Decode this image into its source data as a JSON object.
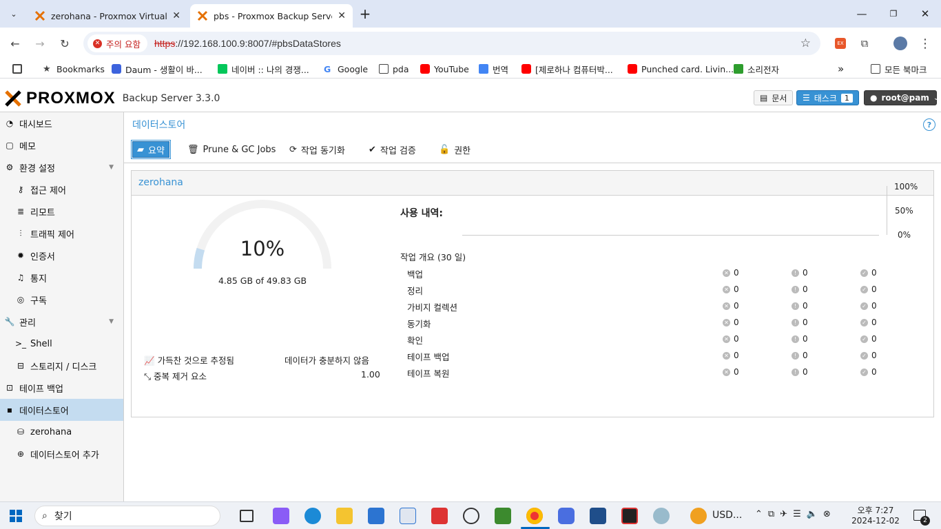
{
  "browser": {
    "tabs": [
      {
        "title": "zerohana - Proxmox Virtual Environment",
        "active": false
      },
      {
        "title": "pbs - Proxmox Backup Server",
        "active": true
      }
    ],
    "security_chip": "주의 요함",
    "url_proto": "https",
    "url_rest": "://192.168.100.9:8007/#pbsDataStores",
    "bookmarks": [
      {
        "label": "Bookmarks"
      },
      {
        "label": "Daum - 생활이 바..."
      },
      {
        "label": "네이버 :: 나의 경쟁..."
      },
      {
        "label": "Google"
      },
      {
        "label": "pda"
      },
      {
        "label": "YouTube"
      },
      {
        "label": "번역"
      },
      {
        "label": "[제로하나 컴퓨터박..."
      },
      {
        "label": "Punched card. Livin..."
      },
      {
        "label": "소리전자"
      }
    ],
    "all_bookmarks": "모든 북마크"
  },
  "pbs": {
    "brand": "PROXMOX",
    "version": "Backup Server 3.3.0",
    "docs_label": "문서",
    "tasks_label": "태스크",
    "tasks_count": "1",
    "user_label": "root@pam"
  },
  "sidebar": {
    "items": [
      {
        "label": "대시보드"
      },
      {
        "label": "메모"
      },
      {
        "label": "환경 설정"
      },
      {
        "label": "접근 제어"
      },
      {
        "label": "리모트"
      },
      {
        "label": "트래픽 제어"
      },
      {
        "label": "인증서"
      },
      {
        "label": "통지"
      },
      {
        "label": "구독"
      },
      {
        "label": "관리"
      },
      {
        "label": "Shell"
      },
      {
        "label": "스토리지 / 디스크"
      },
      {
        "label": "테이프 백업"
      },
      {
        "label": "데이터스토어"
      },
      {
        "label": "zerohana"
      },
      {
        "label": "데이터스토어 추가"
      }
    ]
  },
  "content": {
    "title": "데이터스토어",
    "tabs": [
      {
        "label": "요약"
      },
      {
        "label": "Prune & GC Jobs"
      },
      {
        "label": "작업 동기화"
      },
      {
        "label": "작업 검증"
      },
      {
        "label": "권한"
      }
    ],
    "panel_title": "zerohana",
    "usage_percent": "10%",
    "usage_fraction": 0.0974,
    "usage_text": "4.85 GB of 49.83 GB",
    "estimate_label": "가득찬 것으로 추정됨",
    "estimate_value": "데이터가 충분하지 않음",
    "dedup_label": "중복 제거 요소",
    "dedup_value": "1.00",
    "history_title": "사용 내역:",
    "axis": [
      "100%",
      "50%",
      "0%"
    ],
    "tasks_title": "작업 개요 (30 일)",
    "task_rows": [
      {
        "label": "백업",
        "err": "0",
        "warn": "0",
        "ok": "0"
      },
      {
        "label": "정리",
        "err": "0",
        "warn": "0",
        "ok": "0"
      },
      {
        "label": "가비지 컬렉션",
        "err": "0",
        "warn": "0",
        "ok": "0"
      },
      {
        "label": "동기화",
        "err": "0",
        "warn": "0",
        "ok": "0"
      },
      {
        "label": "확인",
        "err": "0",
        "warn": "0",
        "ok": "0"
      },
      {
        "label": "테이프 백업",
        "err": "0",
        "warn": "0",
        "ok": "0"
      },
      {
        "label": "테이프 복원",
        "err": "0",
        "warn": "0",
        "ok": "0"
      }
    ]
  },
  "taskbar": {
    "search": "찾기",
    "tray_app": "USD...",
    "time": "오후 7:27",
    "date": "2024-12-02",
    "notif_count": "2"
  }
}
